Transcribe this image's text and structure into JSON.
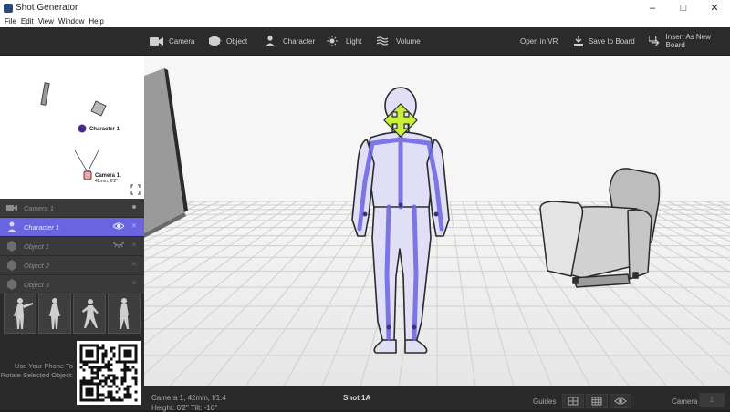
{
  "window": {
    "title": "Shot Generator",
    "min": "–",
    "max": "□",
    "close": "✕"
  },
  "menu": [
    "File",
    "Edit",
    "View",
    "Window",
    "Help"
  ],
  "toolbar": {
    "camera": "Camera",
    "object": "Object",
    "character": "Character",
    "light": "Light",
    "volume": "Volume",
    "open_vr": "Open in VR",
    "save_board": "Save to Board",
    "insert_board": "Insert As New Board"
  },
  "minimap": {
    "character_label": "Character 1",
    "camera_label": "Camera 1,",
    "camera_sub": "42mm, 6'2\""
  },
  "scene_list": [
    {
      "label": "Camera 1",
      "type": "camera-icon",
      "selected": false
    },
    {
      "label": "Character 1",
      "type": "character-icon",
      "selected": true
    },
    {
      "label": "Object 1",
      "type": "object-icon",
      "selected": false
    },
    {
      "label": "Object 2",
      "type": "object-icon",
      "selected": false
    },
    {
      "label": "Object 3",
      "type": "object-icon",
      "selected": false
    }
  ],
  "phone_text": "Use Your Phone To Rotate Selected Object:",
  "status": {
    "camera_info": "Camera 1, 42mm, f/1.4",
    "camera_info2": "Height: 6'2\" Tilt: -10°",
    "shot": "Shot 1A",
    "guides": "Guides",
    "camera_label": "Camera",
    "camera_value": "1"
  },
  "colors": {
    "accent": "#6a64e0",
    "gizmo": "#c8f03c"
  }
}
